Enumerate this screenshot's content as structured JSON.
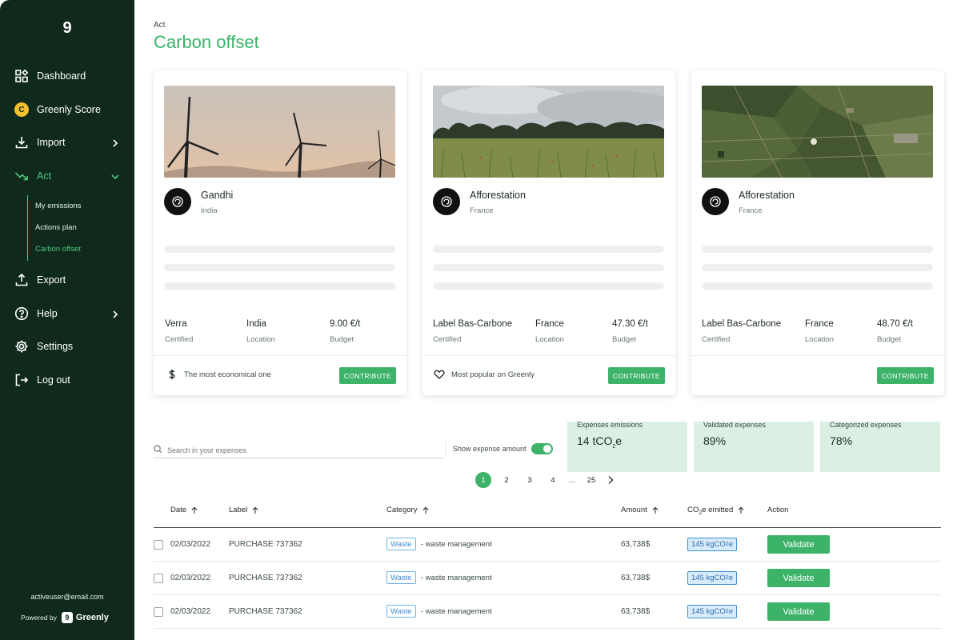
{
  "sidebar": {
    "logo": "9",
    "items": [
      {
        "label": "Dashboard",
        "icon": "dashboard-grid-icon"
      },
      {
        "label": "Greenly Score",
        "icon": "score-badge-icon",
        "badge": "C"
      },
      {
        "label": "Import",
        "icon": "download-icon"
      },
      {
        "label": "Act",
        "icon": "trend-down-icon"
      },
      {
        "label": "Export",
        "icon": "upload-icon"
      },
      {
        "label": "Help",
        "icon": "help-circle-icon"
      },
      {
        "label": "Settings",
        "icon": "gear-icon"
      },
      {
        "label": "Log out",
        "icon": "logout-icon"
      }
    ],
    "sub_items": [
      "My emissions",
      "Actions plan",
      "Carbon offset"
    ],
    "user_email": "activeuser@email.com",
    "powered_by": "Powered by",
    "brand_mark": "9",
    "brand_name": "Greenly"
  },
  "header": {
    "breadcrumb": "Act",
    "title": "Carbon offset"
  },
  "cards": [
    {
      "name": "Gandhi",
      "country": "India",
      "stats": [
        {
          "value": "Verra",
          "key": "Certified"
        },
        {
          "value": "India",
          "key": "Location"
        },
        {
          "value": "9.00 €/t",
          "key": "Budget"
        }
      ],
      "footer": "The most economical one",
      "footer_icon": "dollar-icon",
      "button": "CONTRIBUTE"
    },
    {
      "name": "Afforestation",
      "country": "France",
      "stats": [
        {
          "value": "Label Bas-Carbone",
          "key": "Certified"
        },
        {
          "value": "France",
          "key": "Location"
        },
        {
          "value": "47.30 €/t",
          "key": "Budget"
        }
      ],
      "footer": "Most popular on Greenly",
      "footer_icon": "heart-icon",
      "button": "CONTRIBUTE"
    },
    {
      "name": "Afforestation",
      "country": "France",
      "stats": [
        {
          "value": "Label Bas-Carbone",
          "key": "Certified"
        },
        {
          "value": "France",
          "key": "Location"
        },
        {
          "value": "48.70 €/t",
          "key": "Budget"
        }
      ],
      "footer": "",
      "button": "CONTRIBUTE"
    }
  ],
  "search": {
    "placeholder": "Search in your expenses",
    "toggle_label": "Show expense amount"
  },
  "kpis": [
    {
      "label": "Expenses emissions",
      "value_main": "14 tCO",
      "value_sub": "2",
      "value_tail": "e"
    },
    {
      "label": "Validated expenses",
      "value_main": "89%"
    },
    {
      "label": "Categorized expenses",
      "value_main": "78%"
    }
  ],
  "pagination": {
    "pages": [
      "1",
      "2",
      "3",
      "4"
    ],
    "ellipsis": "…",
    "last": "25",
    "current": "1"
  },
  "table": {
    "headers": {
      "date": "Date",
      "label": "Label",
      "category": "Category",
      "amount": "Amount",
      "co2_main": "CO",
      "co2_sub": "2",
      "co2_tail": "e emitted",
      "action": "Action"
    },
    "rows": [
      {
        "date": "02/03/2022",
        "label": "PURCHASE 737362",
        "tag": "Waste",
        "category": "- waste management",
        "amount": "63,738$",
        "co2_main": "145 kgCO",
        "co2_sub": "2",
        "co2_tail": "e",
        "action": "Validate"
      },
      {
        "date": "02/03/2022",
        "label": "PURCHASE 737362",
        "tag": "Waste",
        "category": "- waste management",
        "amount": "63,738$",
        "co2_main": "145 kgCO",
        "co2_sub": "2",
        "co2_tail": "e",
        "action": "Validate"
      },
      {
        "date": "02/03/2022",
        "label": "PURCHASE 737362",
        "tag": "Waste",
        "category": "- waste management",
        "amount": "63,738$",
        "co2_main": "145 kgCO",
        "co2_sub": "2",
        "co2_tail": "e",
        "action": "Validate"
      }
    ]
  },
  "colors": {
    "sidebar_bg": "#0f2a1c",
    "accent_green": "#3cb369",
    "kpi_bg": "#d9f0e2",
    "tag_blue": "#3d8fd6"
  }
}
